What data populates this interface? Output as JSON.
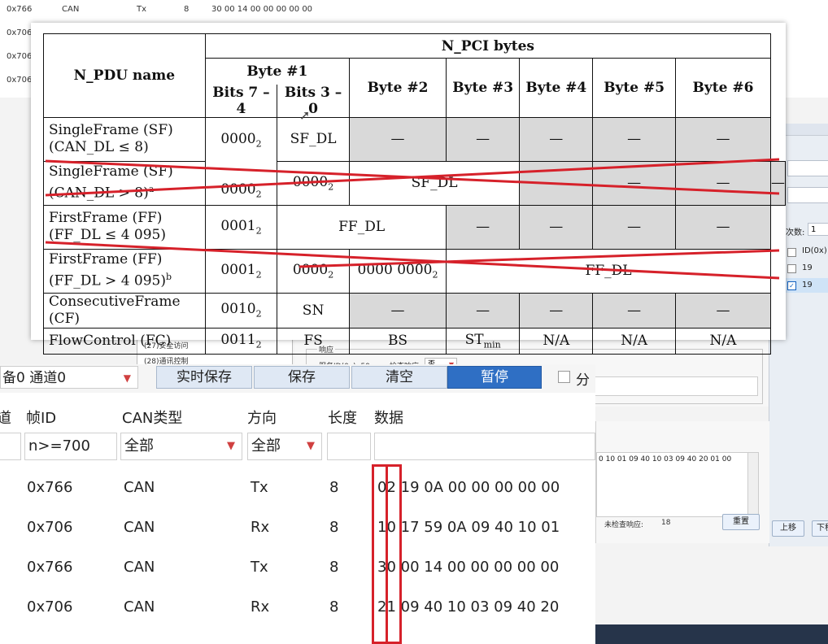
{
  "bg_log": [
    {
      "id": "0x766",
      "type": "CAN",
      "dir": "Tx",
      "len": "8",
      "data": "30 00 14 00 00 00 00 00"
    },
    {
      "id": "0x706"
    },
    {
      "id": "0x706"
    },
    {
      "id": "0x706"
    }
  ],
  "right_panel": {
    "count_label": "次数:",
    "count_value": "1",
    "id_header": "ID(0x)",
    "ids": [
      "19",
      "19"
    ],
    "up_button": "上移",
    "down_button": "下移"
  },
  "mid_config": {
    "tree_items": [
      "(27)安全访问",
      "(28)通讯控制"
    ],
    "response_label": "响应",
    "service_id_text": "服务ID(0x): 59",
    "check_resp_label": "检查响应:",
    "check_resp_value": "否",
    "hex_line": "0 10 01 09 40 10 03 09 40 20 01 00",
    "unchecked_resp_label": "未检查响应:",
    "unchecked_resp_value": "18",
    "reset_button": "重置"
  },
  "toolbar": {
    "device_channel": "备0 通道0",
    "realtime_save": "实时保存",
    "save": "保存",
    "clear": "清空",
    "pause": "暂停",
    "split_label": "分"
  },
  "list": {
    "headers": {
      "channel": "道",
      "frame_id": "帧ID",
      "can_type": "CAN类型",
      "direction": "方向",
      "length": "长度",
      "data": "数据"
    },
    "filters": {
      "frame_id": "n>=700",
      "can_type": "全部",
      "direction": "全部"
    },
    "rows": [
      {
        "id": "0x766",
        "type": "CAN",
        "dir": "Tx",
        "len": "8",
        "data": "02 19 0A 00 00 00 00 00"
      },
      {
        "id": "0x706",
        "type": "CAN",
        "dir": "Rx",
        "len": "8",
        "data": "10 17 59 0A 09 40 10 01"
      },
      {
        "id": "0x766",
        "type": "CAN",
        "dir": "Tx",
        "len": "8",
        "data": "30 00 14 00 00 00 00 00"
      },
      {
        "id": "0x706",
        "type": "CAN",
        "dir": "Rx",
        "len": "8",
        "data": "21 09 40 10 03 09 40 20"
      }
    ]
  },
  "spec": {
    "h_name": "N_PDU name",
    "h_pci": "N_PCI bytes",
    "h_byte1": "Byte #1",
    "h_bits74": "Bits 7 – 4",
    "h_bits30": "Bits 3 – 0",
    "h_byte2": "Byte #2",
    "h_byte3": "Byte #3",
    "h_byte4": "Byte #4",
    "h_byte5": "Byte #5",
    "h_byte6": "Byte #6",
    "dash": "—",
    "na": "N/A",
    "sf1_name1": "SingleFrame (SF)",
    "sf1_name2": "(CAN_DL ≤ 8)",
    "sf1_b74": "0000",
    "sf1_b30": "SF_DL",
    "sf2_name1": "SingleFrame (SF)",
    "sf2_name2": "(CAN_DL > 8)",
    "sf2_name2_sup": "a",
    "sf2_b74": "0000",
    "sf2_b30": "0000",
    "sf2_byte2": "SF_DL",
    "ff1_name1": "FirstFrame (FF)",
    "ff1_name2": "(FF_DL ≤ 4 095)",
    "ff1_b74": "0001",
    "ff1_dl": "FF_DL",
    "ff2_name1": "FirstFrame (FF)",
    "ff2_name2": "(FF_DL > 4 095)",
    "ff2_name2_sup": "b",
    "ff2_b74": "0001",
    "ff2_b30": "0000",
    "ff2_byte2": "0000 0000",
    "ff2_dl": "FF_DL",
    "cf_name": "ConsecutiveFrame (CF)",
    "cf_b74": "0010",
    "cf_b30": "SN",
    "fc_name": "FlowControl (FC)",
    "fc_b74": "0011",
    "fc_b30": "FS",
    "fc_byte2": "BS",
    "fc_byte3": "ST",
    "fc_byte3_sub": "min",
    "binary_sub": "2"
  },
  "colors": {
    "strike_red": "#d6212a",
    "pause_blue": "#2f6fc4",
    "grey_cell": "#d9d9d9"
  }
}
